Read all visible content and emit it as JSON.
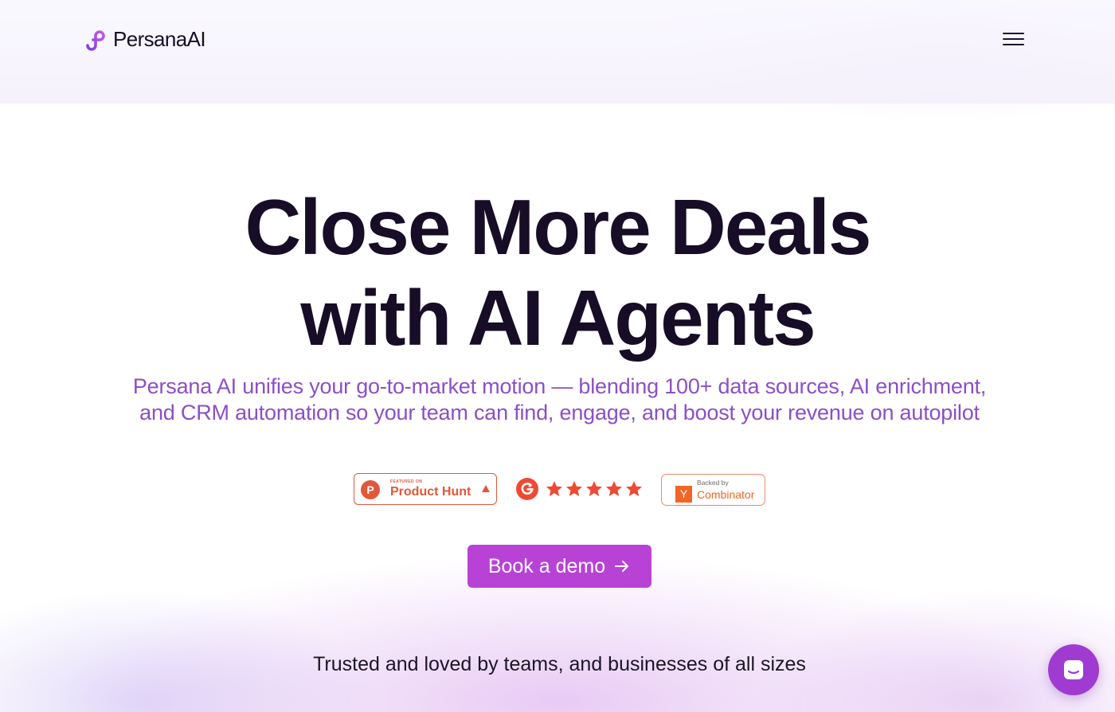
{
  "header": {
    "brand": "PersanaAI",
    "menu_icon": "hamburger-menu-icon"
  },
  "hero": {
    "title_line1": "Close More Deals",
    "title_line2": "with AI Agents",
    "subtitle": "Persana AI unifies your go-to-market motion — blending 100+ data sources, AI enrichment, and CRM automation so your team can find, engage, and boost your revenue on autopilot"
  },
  "badges": {
    "product_hunt": {
      "letter": "P",
      "featured": "FEATURED ON",
      "name": "Product Hunt"
    },
    "g2": {
      "icon": "g2-logo-icon",
      "rating": 5
    },
    "ycombinator": {
      "backed": "Backed by",
      "letter": "Y",
      "name": "Combinator"
    }
  },
  "cta": {
    "label": "Book a demo"
  },
  "trusted": {
    "text": "Trusted and loved by teams, and businesses of all sizes"
  },
  "chat": {
    "icon": "chat-bubble-icon"
  },
  "colors": {
    "accent": "#b842d6",
    "subtitle": "#8c4fc6",
    "title": "#170d26",
    "product_hunt": "#e2573a",
    "ycombinator": "#f26522",
    "chat": "#a03bd2"
  }
}
